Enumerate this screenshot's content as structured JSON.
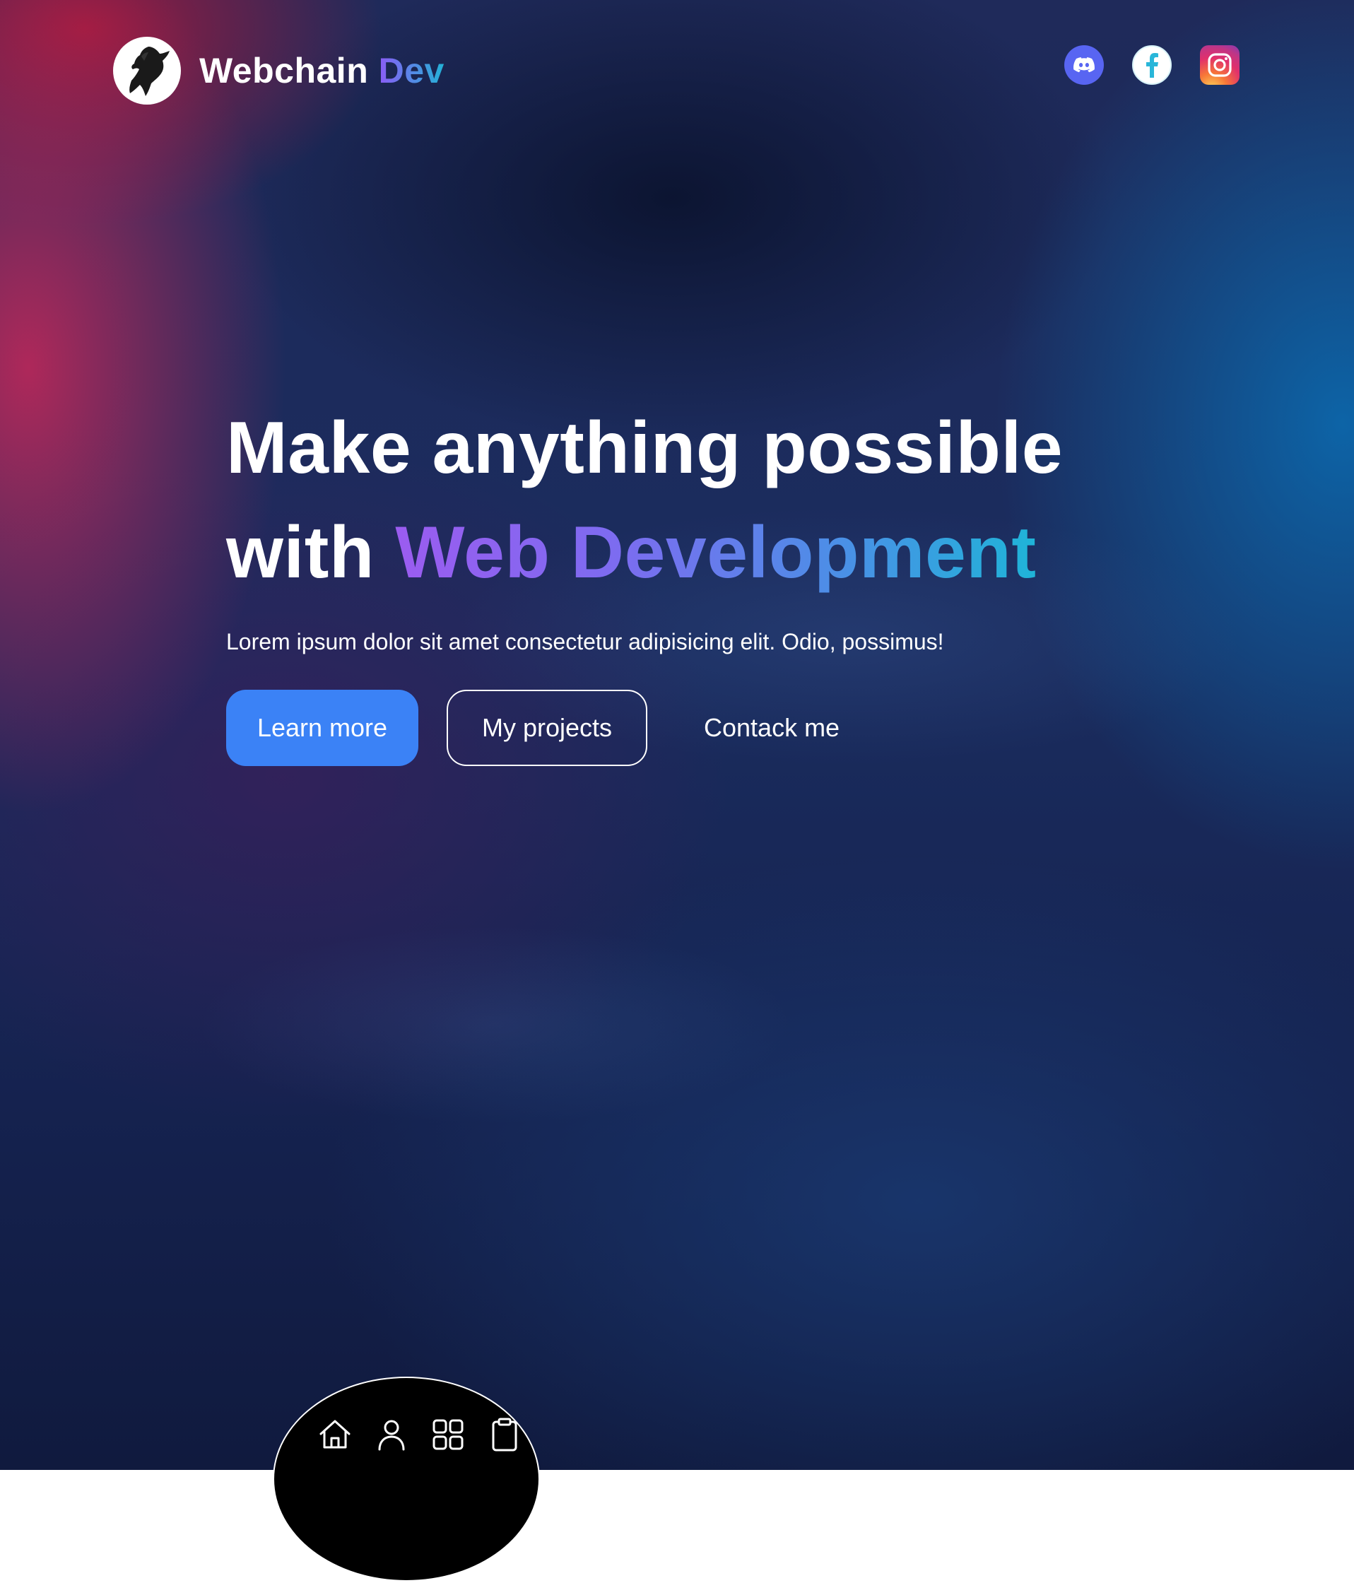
{
  "header": {
    "brand_main": "Webchain",
    "brand_accent": "Dev",
    "logo_icon": "horse-silhouette-icon",
    "socials": [
      {
        "name": "discord",
        "icon": "discord-icon",
        "color": "#5865f2"
      },
      {
        "name": "facebook",
        "icon": "facebook-icon",
        "color": "#29b6d9"
      },
      {
        "name": "instagram",
        "icon": "instagram-icon",
        "color": "#e1306c"
      }
    ]
  },
  "hero": {
    "headline_line1": "Make anything possible",
    "headline_with": "with",
    "headline_gradient": "Web Development",
    "subtext": "Lorem ipsum dolor sit amet consectetur adipisicing elit. Odio, possimus!",
    "buttons": {
      "primary": "Learn more",
      "secondary": "My projects",
      "link": "Contack me"
    }
  },
  "floating_nav": {
    "items": [
      {
        "icon": "home-icon"
      },
      {
        "icon": "user-icon"
      },
      {
        "icon": "grid-icon"
      },
      {
        "icon": "clipboard-icon"
      }
    ]
  },
  "colors": {
    "primary_button": "#3b82f6",
    "gradient_start": "#9b5cf0",
    "gradient_end": "#1fb4d8"
  }
}
